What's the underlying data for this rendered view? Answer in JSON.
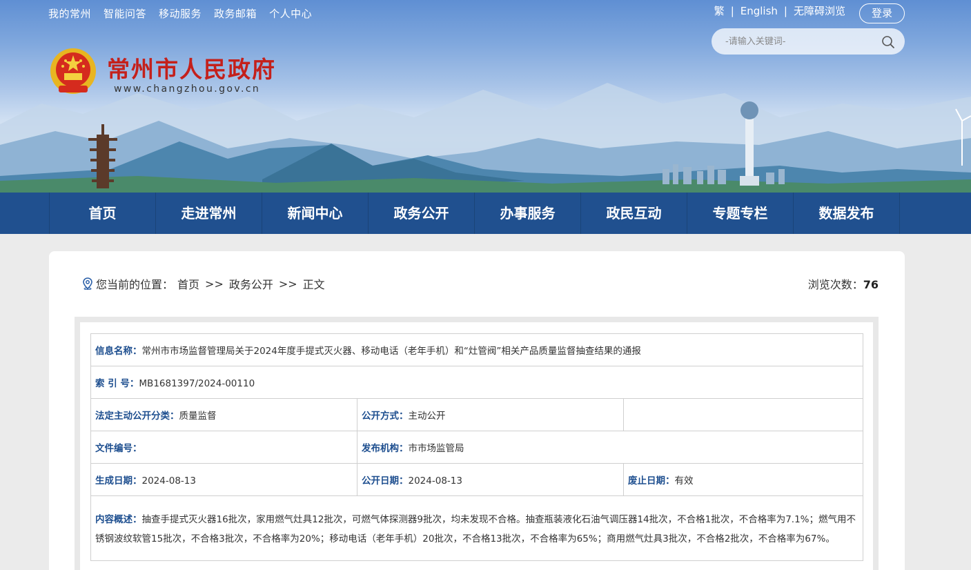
{
  "top_nav": [
    "我的常州",
    "智能问答",
    "移动服务",
    "政务邮箱",
    "个人中心"
  ],
  "top_right": {
    "traditional": "繁",
    "english": "English",
    "accessible": "无障碍浏览",
    "login": "登录"
  },
  "search": {
    "placeholder": "-请输入关键词-"
  },
  "site": {
    "title": "常州市人民政府",
    "url": "www.changzhou.gov.cn"
  },
  "main_nav": [
    "首页",
    "走进常州",
    "新闻中心",
    "政务公开",
    "办事服务",
    "政民互动",
    "专题专栏",
    "数据发布"
  ],
  "breadcrumb": {
    "prefix": "您当前的位置：",
    "items": [
      "首页",
      "政务公开",
      "正文"
    ],
    "separator": ">>"
  },
  "views": {
    "label": "浏览次数：",
    "count": "76"
  },
  "info": {
    "name_label": "信息名称：",
    "name_value": "常州市市场监督管理局关于2024年度手提式灭火器、移动电话（老年手机）和“灶管阀”相关产品质量监督抽查结果的通报",
    "index_label": "索 引 号：",
    "index_value": "MB1681397/2024-00110",
    "category_label": "法定主动公开分类：",
    "category_value": "质量监督",
    "method_label": "公开方式：",
    "method_value": "主动公开",
    "docno_label": "文件编号：",
    "docno_value": "",
    "publisher_label": "发布机构：",
    "publisher_value": "市市场监管局",
    "created_label": "生成日期：",
    "created_value": "2024-08-13",
    "published_label": "公开日期：",
    "published_value": "2024-08-13",
    "expiry_label": "废止日期：",
    "expiry_value": "有效",
    "summary_label": "内容概述：",
    "summary_value": "抽查手提式灭火器16批次，家用燃气灶具12批次，可燃气体探测器9批次，均未发现不合格。抽查瓶装液化石油气调压器14批次，不合格1批次，不合格率为7.1%；燃气用不锈钢波纹软管15批次，不合格3批次，不合格率为20%；移动电话（老年手机）20批次，不合格13批次，不合格率为65%；商用燃气灶具3批次，不合格2批次，不合格率为67%。"
  }
}
